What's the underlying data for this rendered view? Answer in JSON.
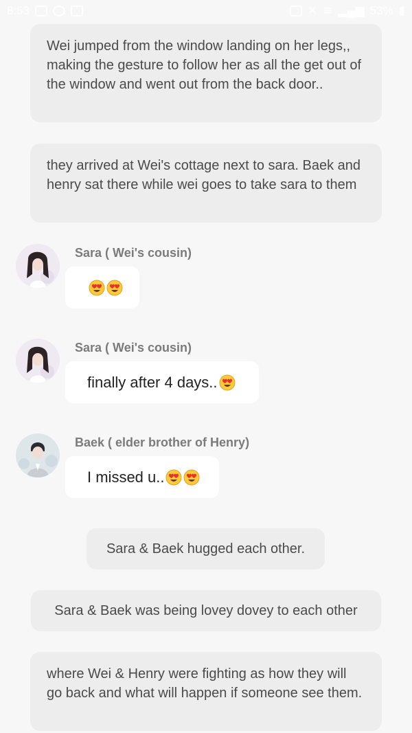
{
  "status_bar": {
    "time": "8:53",
    "battery": "53%"
  },
  "messages": [
    {
      "type": "narration",
      "text": "Wei jumped from the window landing on her legs,, making the gesture to follow her as all the get out of the window and went out from the back door.."
    },
    {
      "type": "narration",
      "text": "they arrived at Wei's cottage next to sara. Baek and henry sat there while wei goes to take sara to them"
    },
    {
      "type": "chat",
      "sender": "Sara ( Wei's cousin)",
      "text": "",
      "emojis": 2
    },
    {
      "type": "chat",
      "sender": "Sara ( Wei's cousin)",
      "text": "finally after 4 days..",
      "emojis": 1
    },
    {
      "type": "chat",
      "sender": "Baek ( elder brother of Henry)",
      "text": "I missed u..",
      "emojis": 2
    },
    {
      "type": "narration",
      "text": "Sara & Baek hugged each other."
    },
    {
      "type": "narration",
      "text": "Sara & Baek was being lovey dovey to each other"
    },
    {
      "type": "narration",
      "text": "where Wei & Henry were fighting as how they will go back and what will happen if someone see them."
    }
  ],
  "colors": {
    "background": "#f7f7f7",
    "narration_bg": "#ededed",
    "bubble_bg": "#ffffff",
    "sender_text": "#7b7b7b"
  },
  "icons": [
    "heart-eyes-emoji-icon",
    "sara-avatar-icon",
    "baek-avatar-icon"
  ]
}
